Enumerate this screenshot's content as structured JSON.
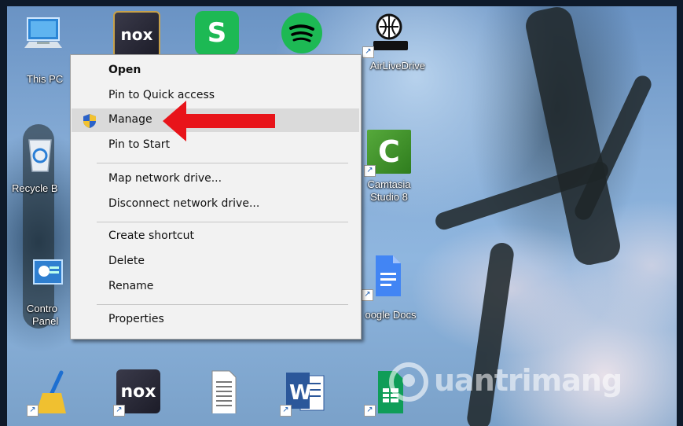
{
  "desktop": {
    "icons": [
      {
        "name": "this-pc",
        "label": "This PC",
        "icon": "computer-icon"
      },
      {
        "name": "recycle-bin",
        "label": "Recycle B",
        "icon": "recycle-bin-icon"
      },
      {
        "name": "control-panel",
        "label": "Control\nPanel",
        "label_line1": "Contro",
        "label_line2": "Panel",
        "icon": "control-panel-icon"
      },
      {
        "name": "nox-top",
        "label": "",
        "icon": "nox-icon"
      },
      {
        "name": "sheets-s",
        "label": "",
        "icon": "s-app-icon"
      },
      {
        "name": "spotify",
        "label": "",
        "icon": "spotify-icon"
      },
      {
        "name": "airlivedrive",
        "label": "AirLiveDrive",
        "icon": "airlivedrive-icon"
      },
      {
        "name": "camtasia",
        "label_line1": "Camtasia",
        "label_line2": "Studio 8",
        "icon": "camtasia-icon"
      },
      {
        "name": "google-docs",
        "label": "oogle Docs",
        "icon": "google-docs-icon"
      },
      {
        "name": "ccleaner",
        "label": "",
        "icon": "broom-icon"
      },
      {
        "name": "nox-bottom",
        "label": "",
        "icon": "nox-icon"
      },
      {
        "name": "text-file",
        "label": "",
        "icon": "document-icon"
      },
      {
        "name": "word",
        "label": "",
        "icon": "word-icon"
      },
      {
        "name": "sheets",
        "label": "",
        "icon": "google-sheets-icon"
      }
    ]
  },
  "context_menu": {
    "items": [
      {
        "label": "Open",
        "bold": true
      },
      {
        "label": "Pin to Quick access"
      },
      {
        "label": "Manage",
        "icon": "shield-icon",
        "highlighted": true
      },
      {
        "label": "Pin to Start"
      },
      {
        "label": "Map network drive..."
      },
      {
        "label": "Disconnect network drive..."
      },
      {
        "label": "Create shortcut"
      },
      {
        "label": "Delete"
      },
      {
        "label": "Rename"
      },
      {
        "label": "Properties"
      }
    ]
  },
  "watermark": {
    "text": "uantrimang"
  },
  "colors": {
    "arrow": "#e8141a",
    "menu_bg": "#f2f2f2",
    "menu_highlight": "#dadada"
  }
}
